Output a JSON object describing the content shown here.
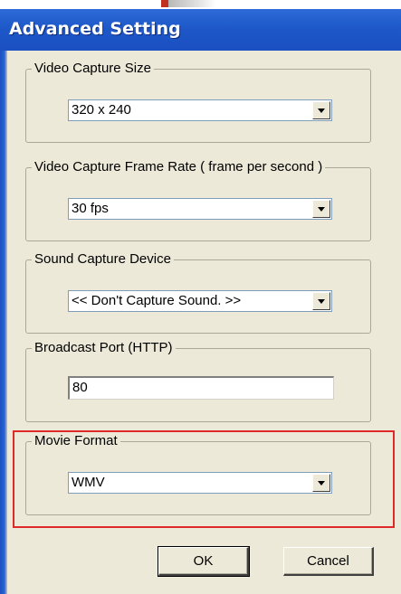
{
  "window": {
    "title": "Advanced Setting"
  },
  "groups": {
    "video_size": {
      "label": "Video Capture Size",
      "value": "320 x 240"
    },
    "frame_rate": {
      "label": "Video Capture Frame Rate ( frame per second )",
      "value": "30 fps"
    },
    "sound_device": {
      "label": "Sound Capture Device",
      "value": "<< Don't Capture Sound. >>"
    },
    "broadcast_port": {
      "label": "Broadcast Port (HTTP)",
      "value": "80"
    },
    "movie_format": {
      "label": "Movie Format",
      "value": "WMV"
    }
  },
  "buttons": {
    "ok": "OK",
    "cancel": "Cancel"
  },
  "colors": {
    "titlebar": "#1e58c9",
    "dialog_bg": "#ece9d8",
    "highlight": "#e02a2a"
  }
}
